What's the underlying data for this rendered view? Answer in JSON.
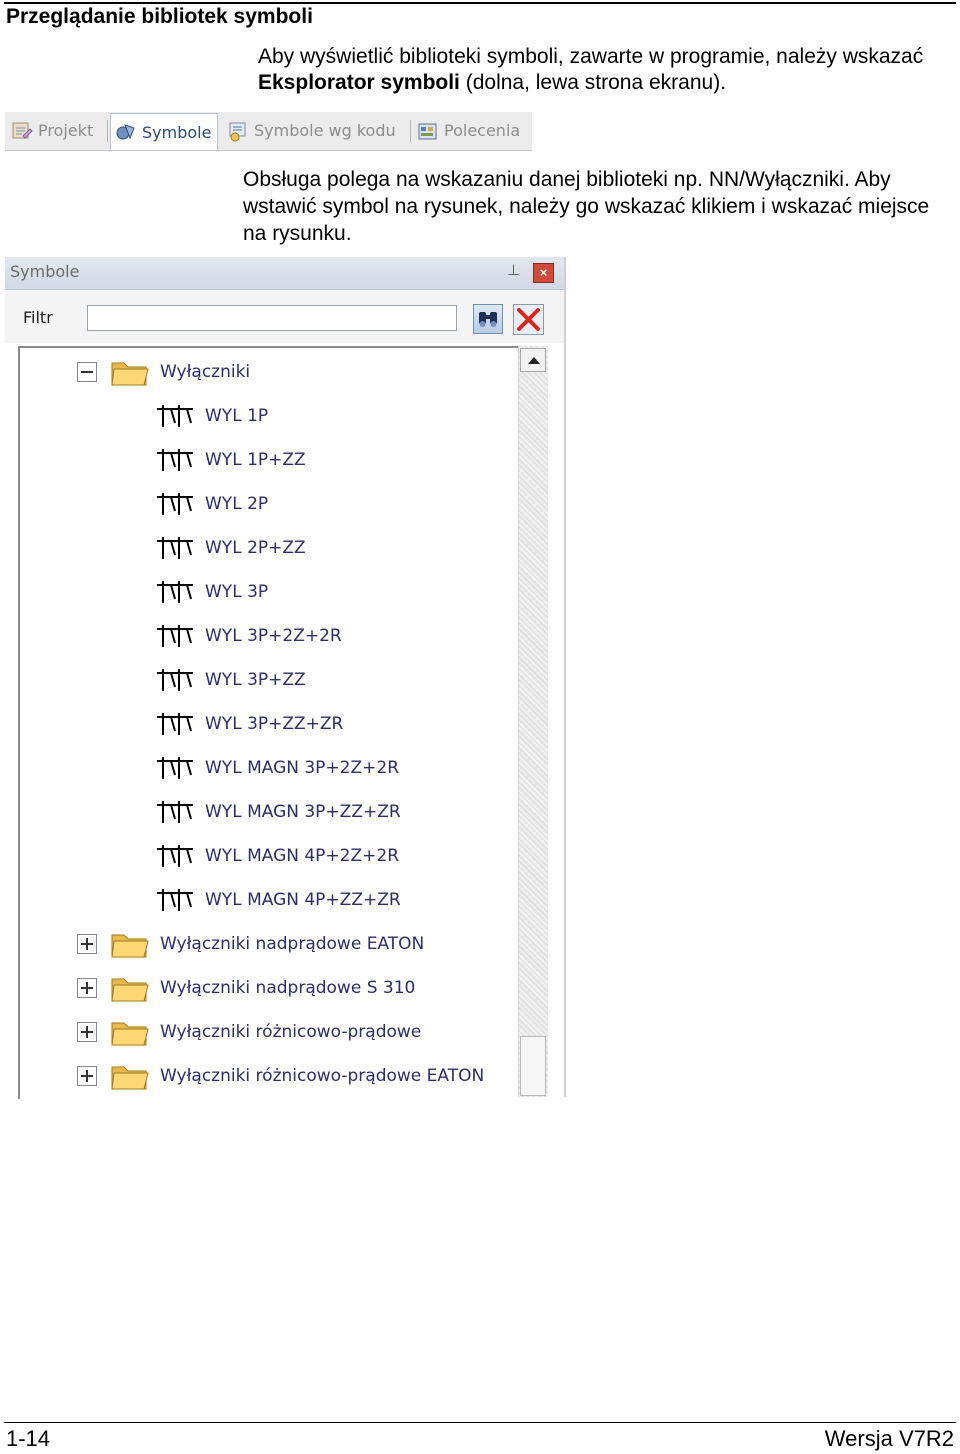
{
  "page": {
    "heading": "Przeglądanie bibliotek symboli",
    "intro_pre": "Aby wyświetlić biblioteki symboli, zawarte w programie, należy wskazać ",
    "intro_bold": "Eksplorator symboli",
    "intro_post": " (dolna, lewa strona ekranu).",
    "description": "Obsługa polega na wskazaniu danej biblioteki np. NN/Wyłączniki. Aby wstawić symbol na rysunek, należy go wskazać klikiem i wskazać miejsce na rysunku.",
    "page_number": "1-14",
    "version": "Wersja V7R2"
  },
  "tabs": [
    {
      "label": "Projekt",
      "icon": "project-icon",
      "active": false
    },
    {
      "label": "Symbole",
      "icon": "symbols-icon",
      "active": true
    },
    {
      "label": "Symbole wg kodu",
      "icon": "symbols-by-code-icon",
      "active": false
    },
    {
      "label": "Polecenia",
      "icon": "commands-icon",
      "active": false
    }
  ],
  "panel": {
    "title": "Symbole",
    "filter_label": "Filtr",
    "filter_value": "",
    "tree": {
      "root": {
        "label": "Wyłączniki",
        "expanded": true
      },
      "children": [
        "WYL 1P",
        "WYL 1P+ZZ",
        "WYL 2P",
        "WYL 2P+ZZ",
        "WYL 3P",
        "WYL 3P+2Z+2R",
        "WYL 3P+ZZ",
        "WYL 3P+ZZ+ZR",
        "WYL MAGN 3P+2Z+2R",
        "WYL MAGN 3P+ZZ+ZR",
        "WYL MAGN 4P+2Z+2R",
        "WYL MAGN 4P+ZZ+ZR"
      ],
      "folders": [
        {
          "label": "Wyłączniki nadprądowe EATON",
          "expanded": false
        },
        {
          "label": "Wyłączniki nadprądowe S 310",
          "expanded": false
        },
        {
          "label": "Wyłączniki różnicowo-prądowe",
          "expanded": false
        },
        {
          "label": "Wyłączniki różnicowo-prądowe EATON",
          "expanded": false
        }
      ]
    }
  },
  "colors": {
    "tab_active_text": "#2b4a77",
    "tree_text": "#2d2d6e",
    "close_red": "#cf4a3a"
  }
}
